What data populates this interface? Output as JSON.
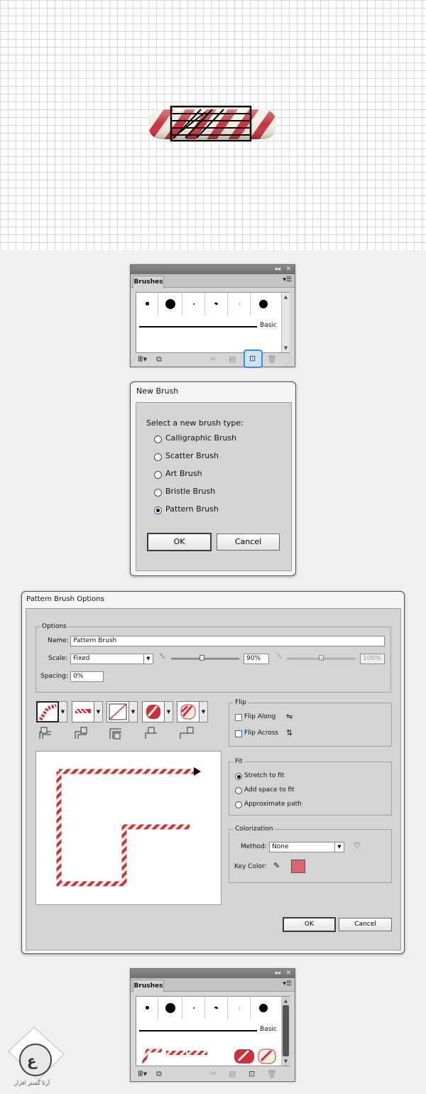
{
  "brushes_panel_1": {
    "tab_label": "Brushes",
    "basic_label": "Basic"
  },
  "new_brush_dialog": {
    "title": "New Brush",
    "prompt": "Select a new brush type:",
    "options": [
      "Calligraphic Brush",
      "Scatter Brush",
      "Art Brush",
      "Bristle Brush",
      "Pattern Brush"
    ],
    "selected_option": "Pattern Brush",
    "ok_label": "OK",
    "cancel_label": "Cancel"
  },
  "pattern_brush_options": {
    "title": "Pattern Brush Options",
    "options_group": "Options",
    "name_label": "Name:",
    "name_value": "Pattern Brush",
    "scale_label": "Scale:",
    "scale_value": "Fixed",
    "scale_percent": "90%",
    "scale_percent_max": "100%",
    "spacing_label": "Spacing:",
    "spacing_value": "0%",
    "flip_group": "Flip",
    "flip_along": "Flip Along",
    "flip_across": "Flip Across",
    "fit_group": "Fit",
    "fit_options": [
      "Stretch to fit",
      "Add space to fit",
      "Approximate path"
    ],
    "fit_selected": "Stretch to fit",
    "colorization_group": "Colorization",
    "method_label": "Method:",
    "method_value": "None",
    "key_color_label": "Key Color:",
    "ok_label": "OK",
    "cancel_label": "Cancel"
  },
  "brushes_panel_2": {
    "tab_label": "Brushes",
    "basic_label": "Basic"
  },
  "watermark": {
    "text": "آرنا گستر افزار"
  },
  "colors": {
    "candy_red": "#c8323e",
    "key_color": "#e06470",
    "highlight_blue": "#3a8fd6"
  }
}
